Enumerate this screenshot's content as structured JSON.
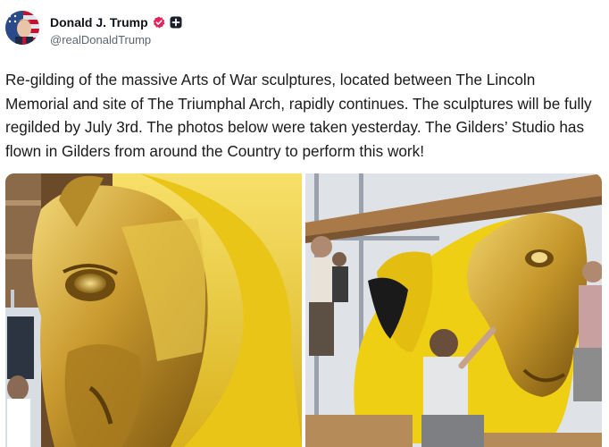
{
  "author": {
    "name": "Donald J. Trump",
    "handle": "@realDonaldTrump",
    "verified_color": "#e0245e",
    "avatar_icon": "flag-portrait"
  },
  "post": {
    "text": "Re-gilding of the massive Arts of War sculptures, located between The Lincoln Memorial and site of The Triumphal Arch, rapidly continues. The sculptures will be fully regilded by July 3rd. The photos below were taken yesterday. The Gilders’ Studio has flown in Gilders from around the Country to perform this work!"
  },
  "media": {
    "count": 2,
    "accent_gold": "#d4af37",
    "accent_yellow": "#f2d000"
  }
}
